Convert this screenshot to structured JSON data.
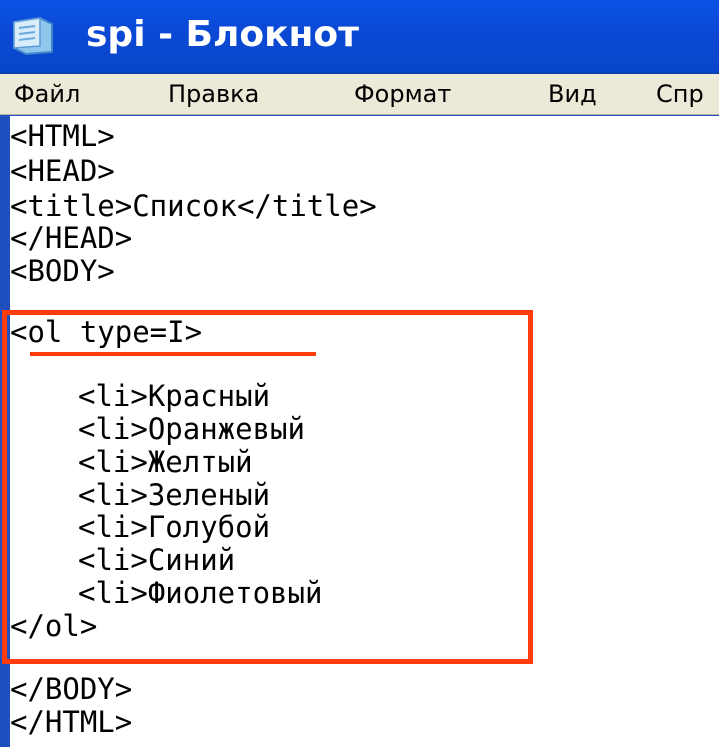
{
  "window": {
    "title": "spi - Блокнот",
    "icon": "notepad-icon"
  },
  "menu": {
    "items": [
      "Файл",
      "Правка",
      "Формат",
      "Вид",
      "Спр"
    ]
  },
  "editor": {
    "lines": [
      "<HTML>",
      "<HEAD>",
      "<title>Список</title>",
      "</HEAD>",
      "<BODY>",
      "<ol type=I>",
      "<li>Красный",
      "<li>Оранжевый",
      "<li>Желтый",
      "<li>Зеленый",
      "<li>Голубой",
      "<li>Синий",
      "<li>Фиолетовый",
      "</ol>",
      "</BODY>",
      "</HTML>"
    ]
  },
  "annotation": {
    "color": "#ff3c0a"
  }
}
